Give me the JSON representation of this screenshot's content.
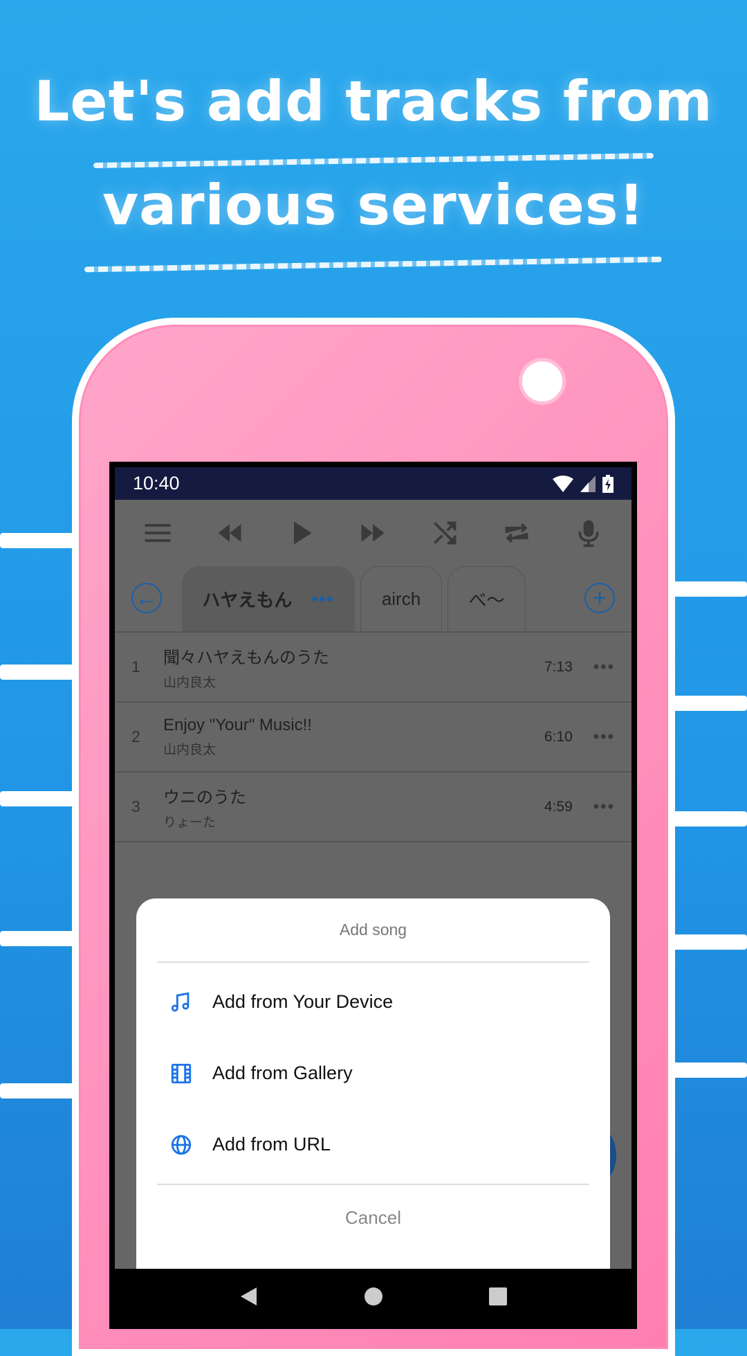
{
  "headline": {
    "line1": "Let's add tracks from",
    "line2": "various services!"
  },
  "colors": {
    "background": "#2aa8ec",
    "phone": "#ff8cb8",
    "accent": "#1a73e8",
    "status_bar": "#151a40"
  },
  "status_bar": {
    "time": "10:40",
    "icons": [
      "wifi-icon",
      "signal-icon",
      "battery-charging-icon"
    ]
  },
  "toolbar": {
    "icons": [
      "menu-icon",
      "rewind-icon",
      "play-icon",
      "fast-forward-icon",
      "shuffle-icon",
      "repeat-icon",
      "microphone-icon"
    ]
  },
  "tabs": [
    {
      "label": "ハヤえもん",
      "active": true
    },
    {
      "label": "airch"
    },
    {
      "label": "べ〜"
    }
  ],
  "tracks": [
    {
      "num": "1",
      "title": "聞々ハヤえもんのうた",
      "artist": "山内良太",
      "duration": "7:13"
    },
    {
      "num": "2",
      "title": "Enjoy \"Your\" Music!!",
      "artist": "山内良太",
      "duration": "6:10"
    },
    {
      "num": "3",
      "title": "ウニのうた",
      "artist": "りょーた",
      "duration": "4:59"
    }
  ],
  "dialog": {
    "title": "Add song",
    "options": [
      {
        "label": "Add from Your Device",
        "icon": "music-note-icon"
      },
      {
        "label": "Add from Gallery",
        "icon": "film-icon"
      },
      {
        "label": "Add from URL",
        "icon": "globe-icon"
      }
    ],
    "cancel": "Cancel"
  }
}
